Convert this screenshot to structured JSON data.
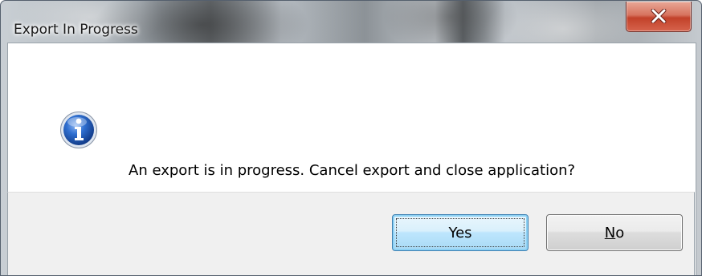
{
  "window": {
    "title": "Export In Progress",
    "close_icon": "close-icon"
  },
  "dialog": {
    "icon": "info-icon",
    "message": "An export is in progress. Cancel export and close application?"
  },
  "buttons": {
    "yes_label": "Yes",
    "no_accel": "N",
    "no_rest": "o"
  },
  "colors": {
    "close_button_red": "#c2412a",
    "default_button_blue": "#3c7fb1",
    "info_icon_blue": "#1e57b8",
    "button_bar_gray": "#f0f0f0"
  }
}
